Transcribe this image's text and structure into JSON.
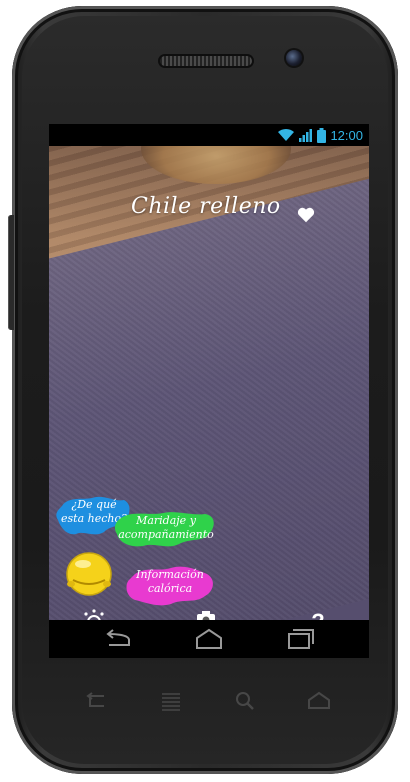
{
  "status_bar": {
    "time": "12:00",
    "icons": [
      "wifi-icon",
      "signal-icon",
      "battery-icon"
    ],
    "accent_color": "#33b5e5"
  },
  "app": {
    "dish_title": "Chile relleno",
    "favorite_icon": "heart-icon"
  },
  "menu": {
    "ingredients_label": "¿De qué esta hecho?",
    "pairing_label": "Maridaje y acompañamiento",
    "calories_label": "Información calórica",
    "colors": {
      "ingredients": "#1e8fe0",
      "pairing": "#2fd24a",
      "calories": "#e83ad0",
      "mascot": "#f5d21a"
    }
  },
  "toolbar": {
    "settings_icon": "sun-settings-icon",
    "camera_icon": "camera-switch-icon",
    "help_label": "?"
  },
  "navigation": {
    "back_icon": "back-icon",
    "home_icon": "home-icon",
    "recents_icon": "recent-apps-icon"
  },
  "hardware": {
    "buttons": [
      "back-icon",
      "menu-icon",
      "search-icon",
      "home-icon"
    ]
  }
}
